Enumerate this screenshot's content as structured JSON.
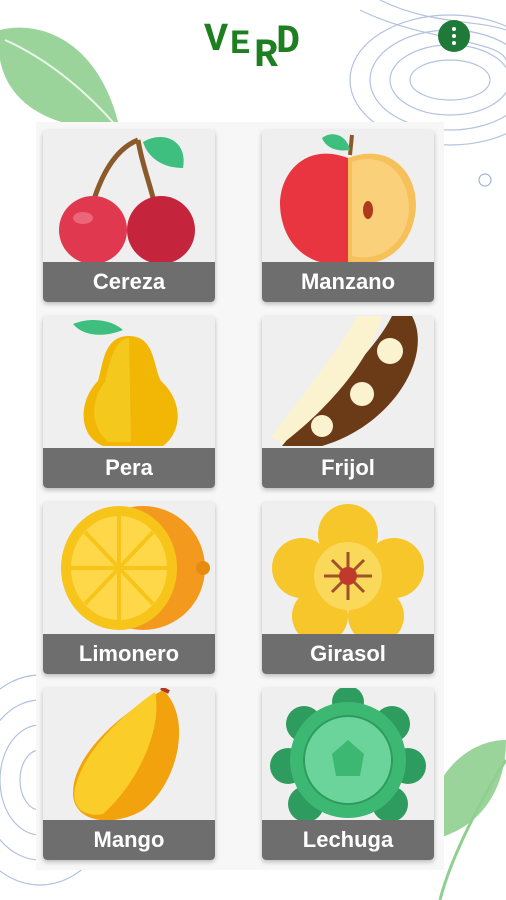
{
  "app": {
    "logo_letters": [
      "V",
      "E",
      "R",
      "D"
    ],
    "brand_color": "#1d7f1f",
    "menu_icon": "more-vertical-icon",
    "accent_color": "#1f7a3a"
  },
  "plants": [
    {
      "label": "Cereza",
      "icon": "cherry-icon"
    },
    {
      "label": "Manzano",
      "icon": "apple-icon"
    },
    {
      "label": "Pera",
      "icon": "pear-icon"
    },
    {
      "label": "Frijol",
      "icon": "bean-icon"
    },
    {
      "label": "Limonero",
      "icon": "lemon-icon"
    },
    {
      "label": "Girasol",
      "icon": "flower-icon"
    },
    {
      "label": "Mango",
      "icon": "mango-icon"
    },
    {
      "label": "Lechuga",
      "icon": "lettuce-icon"
    }
  ]
}
